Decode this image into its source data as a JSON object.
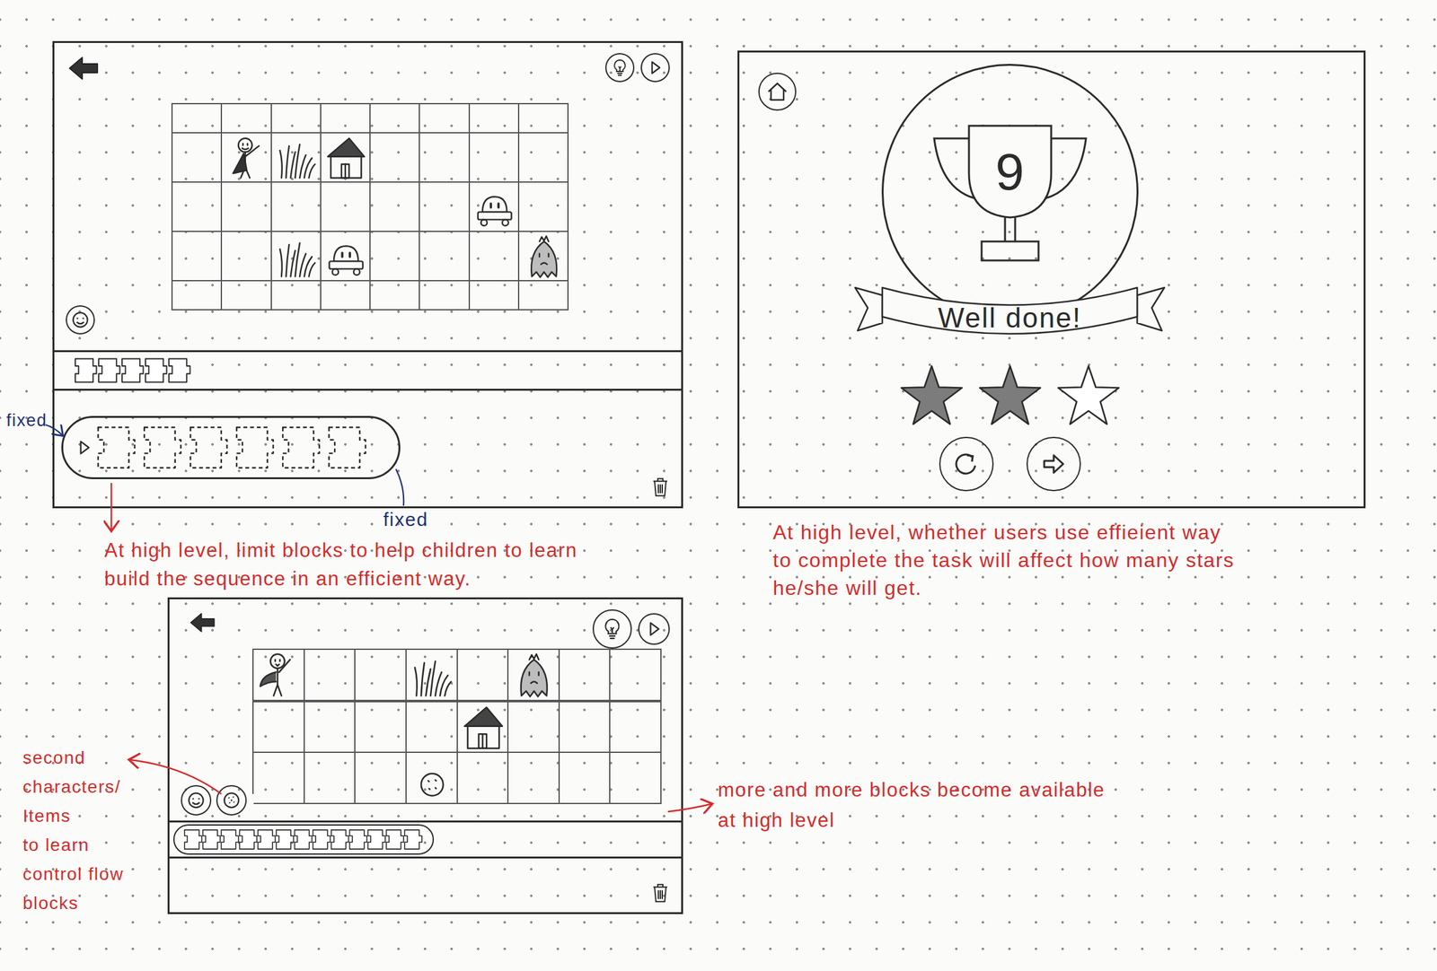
{
  "annotations": [
    {
      "lines": [
        "fixed"
      ],
      "color": "#1f2f7a"
    },
    {
      "lines": [
        "fixed"
      ],
      "color": "#1f2f7a"
    },
    {
      "lines": [
        "At high level, limit blocks to help children to learn",
        "build the sequence in an efficient way."
      ],
      "color": "#d42b2b"
    },
    {
      "lines": [
        "At high level, whether users use effieient way",
        "to complete the task will affect how many stars",
        "he/she will get."
      ],
      "color": "#d42b2b"
    },
    {
      "lines": [
        "second",
        "characters/",
        "Items",
        "to learn",
        "control flow",
        "blocks"
      ],
      "color": "#d42b2b"
    },
    {
      "lines": [
        "more and more blocks become available",
        "at high level"
      ],
      "color": "#d42b2b"
    }
  ],
  "result": {
    "trophy": "9",
    "banner": "Well done!",
    "stars": 2
  }
}
